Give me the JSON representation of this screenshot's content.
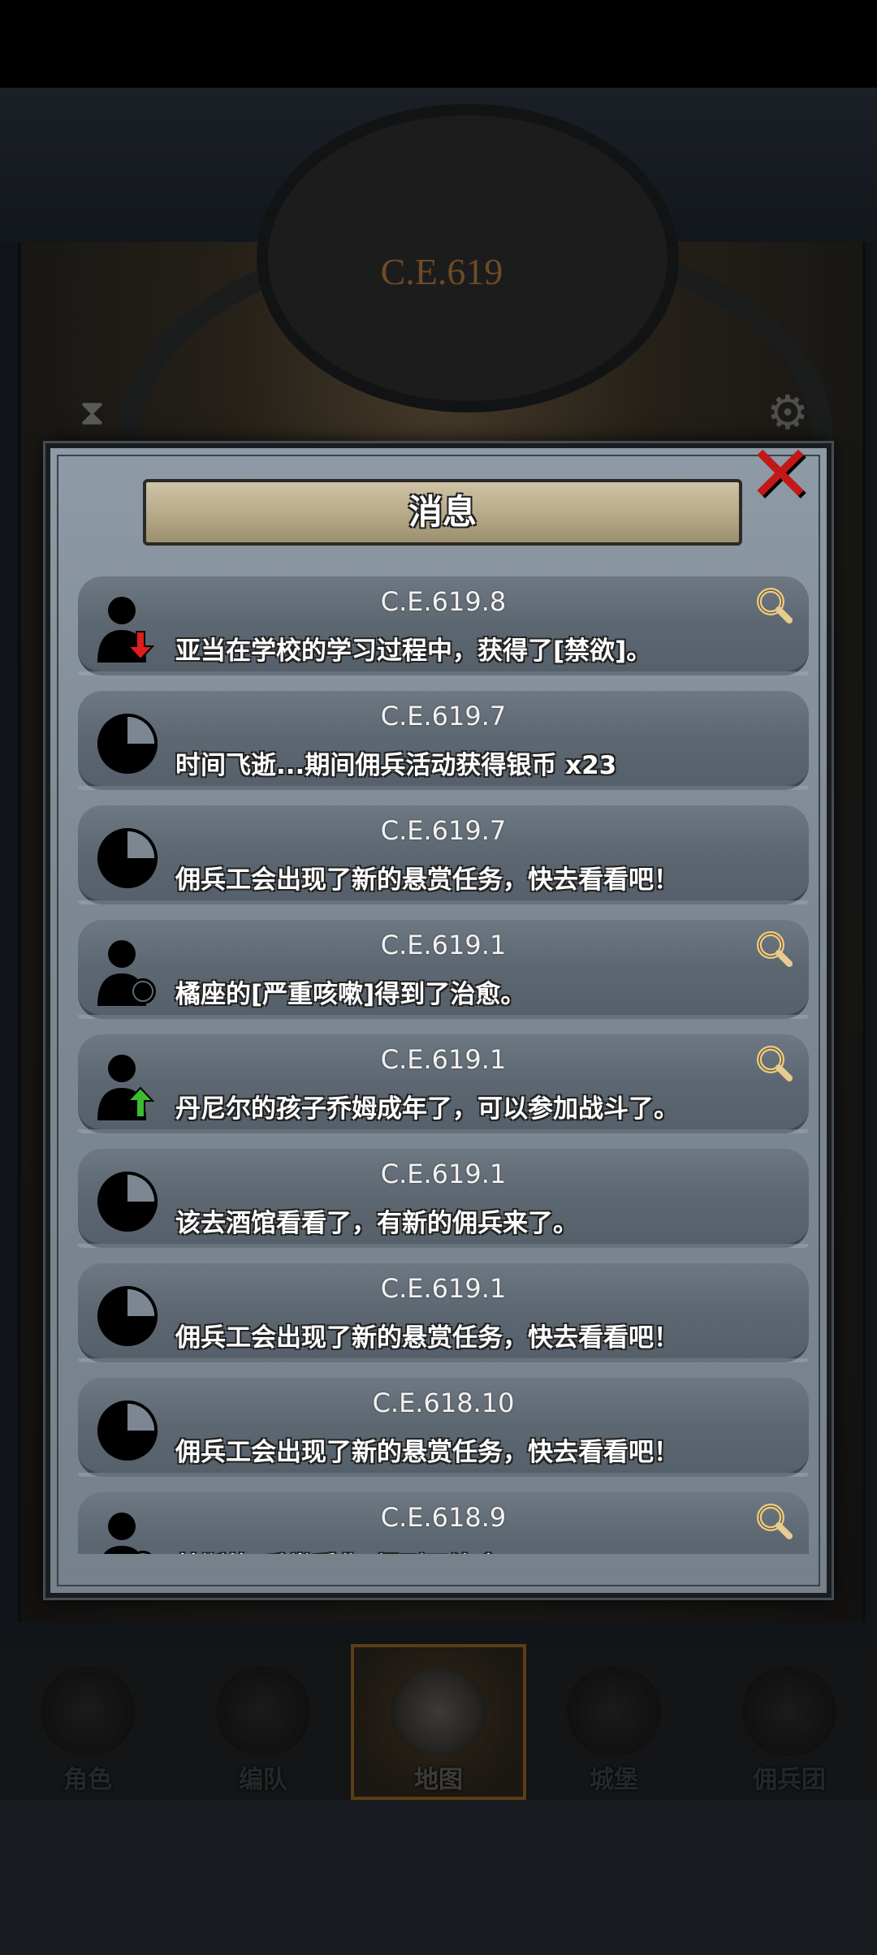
{
  "header": {
    "year_label": "C.E.619"
  },
  "modal": {
    "title": "消息",
    "messages": [
      {
        "date": "C.E.619.8",
        "text": "亚当在学校的学习过程中，获得了[禁欲]。",
        "icon": "person-down-arrow-icon",
        "has_search": true
      },
      {
        "date": "C.E.619.7",
        "text": "时间飞逝...期间佣兵活动获得银币 x23",
        "icon": "clock-icon",
        "has_search": false
      },
      {
        "date": "C.E.619.7",
        "text": "佣兵工会出现了新的悬赏任务，快去看看吧！",
        "icon": "clock-icon",
        "has_search": false
      },
      {
        "date": "C.E.619.1",
        "text": "橘座的[严重咳嗽]得到了治愈。",
        "icon": "person-heal-icon",
        "has_search": true
      },
      {
        "date": "C.E.619.1",
        "text": "丹尼尔的孩子乔姆成年了，可以参加战斗了。",
        "icon": "person-up-arrow-icon",
        "has_search": true
      },
      {
        "date": "C.E.619.1",
        "text": "该去酒馆看看了，有新的佣兵来了。",
        "icon": "clock-icon",
        "has_search": false
      },
      {
        "date": "C.E.619.1",
        "text": "佣兵工会出现了新的悬赏任务，快去看看吧！",
        "icon": "clock-icon",
        "has_search": false
      },
      {
        "date": "C.E.618.10",
        "text": "佣兵工会出现了新的悬赏任务，快去看看吧！",
        "icon": "clock-icon",
        "has_search": false
      },
      {
        "date": "C.E.618.9",
        "text": "基斯的[手掌受伤]得到了治愈。",
        "icon": "person-heal-icon",
        "has_search": true
      }
    ]
  },
  "nav": {
    "items": [
      {
        "label": "角色"
      },
      {
        "label": "编队"
      },
      {
        "label": "地图",
        "active": true
      },
      {
        "label": "城堡"
      },
      {
        "label": "佣兵团"
      }
    ]
  },
  "colors": {
    "accent": "#8e5f20",
    "close": "#c41818",
    "arrow_down": "#e01e1e",
    "arrow_up": "#3dbb2e"
  }
}
